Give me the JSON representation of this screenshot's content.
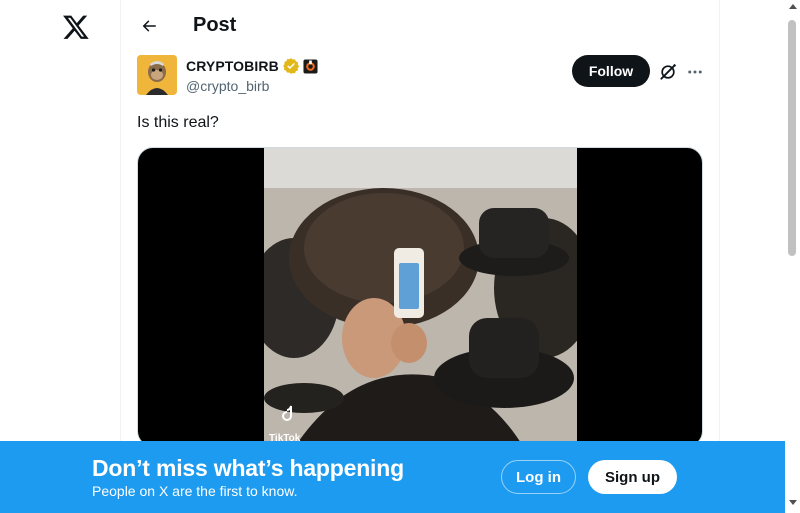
{
  "app": {
    "logo_icon": "x-logo-icon"
  },
  "header": {
    "title": "Post",
    "back_icon": "arrow-left-icon"
  },
  "post": {
    "author_name": "CRYPTOBIRB",
    "author_handle": "@crypto_birb",
    "verified_badge": "verified-badge-icon",
    "affiliate_badge": "affiliate-badge-icon",
    "follow_label": "Follow",
    "text": "Is this real?",
    "media": {
      "watermark": "TikTok"
    }
  },
  "banner": {
    "title": "Don’t miss what’s happening",
    "subtitle": "People on X are the first to know.",
    "login_label": "Log in",
    "signup_label": "Sign up"
  },
  "colors": {
    "accent": "#1d9bf0",
    "text": "#0f1419",
    "secondary_text": "#536471",
    "verified_gold": "#e2b719"
  }
}
